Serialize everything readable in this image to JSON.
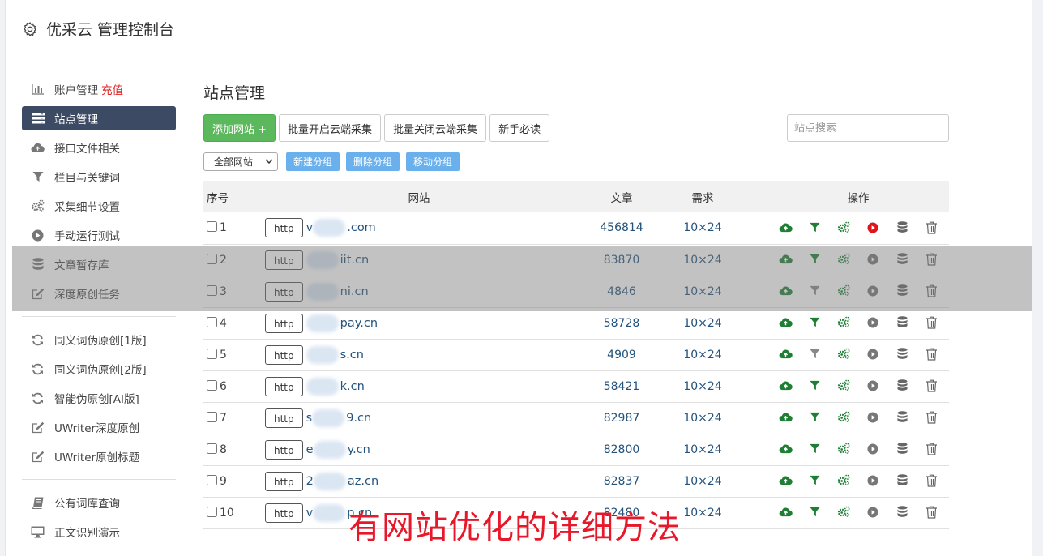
{
  "header": {
    "title": "优采云 管理控制台"
  },
  "sidebar": {
    "group1": [
      {
        "label": "账户管理",
        "badge": "充值",
        "icon": "bar-chart-icon"
      },
      {
        "label": "站点管理",
        "icon": "server-list-icon",
        "active": true
      },
      {
        "label": "接口文件相关",
        "icon": "cloud-upload-icon"
      },
      {
        "label": "栏目与关键词",
        "icon": "filter-icon"
      },
      {
        "label": "采集细节设置",
        "icon": "cogs-icon"
      },
      {
        "label": "手动运行测试",
        "icon": "play-circle-icon"
      },
      {
        "label": "文章暂存库",
        "icon": "database-icon"
      },
      {
        "label": "深度原创任务",
        "icon": "edit-icon"
      }
    ],
    "group2": [
      {
        "label": "同义词伪原创[1版]",
        "icon": "refresh-icon"
      },
      {
        "label": "同义词伪原创[2版]",
        "icon": "refresh-icon"
      },
      {
        "label": "智能伪原创[AI版]",
        "icon": "refresh-icon"
      },
      {
        "label": "UWriter深度原创",
        "icon": "edit-icon"
      },
      {
        "label": "UWriter原创标题",
        "icon": "edit-icon"
      }
    ],
    "group3": [
      {
        "label": "公有词库查询",
        "icon": "book-icon"
      },
      {
        "label": "正文识别演示",
        "icon": "monitor-icon"
      }
    ]
  },
  "main": {
    "title": "站点管理",
    "add_site_label": "添加网站 +",
    "batch_on_label": "批量开启云端采集",
    "batch_off_label": "批量关闭云端采集",
    "newbie_label": "新手必读",
    "search_placeholder": "站点搜索",
    "group_select": "全部网站",
    "new_group_label": "新建分组",
    "delete_group_label": "删除分组",
    "move_group_label": "移动分组"
  },
  "table": {
    "headers": {
      "no": "序号",
      "site": "网站",
      "articles": "文章",
      "demand": "需求",
      "ops": "操作"
    },
    "rows": [
      {
        "no": "1",
        "protocol": "http",
        "site": "v",
        "site_tail": ".com",
        "articles": "456814",
        "demand": "10×24",
        "filter_active": true,
        "play_active": true
      },
      {
        "no": "2",
        "protocol": "http",
        "site": "",
        "site_tail": "iit.cn",
        "articles": "83870",
        "demand": "10×24",
        "filter_active": true,
        "play_active": false
      },
      {
        "no": "3",
        "protocol": "http",
        "site": "",
        "site_tail": "ni.cn",
        "articles": "4846",
        "demand": "10×24",
        "filter_active": false,
        "play_active": false
      },
      {
        "no": "4",
        "protocol": "http",
        "site": "",
        "site_tail": "pay.cn",
        "articles": "58728",
        "demand": "10×24",
        "filter_active": true,
        "play_active": false
      },
      {
        "no": "5",
        "protocol": "http",
        "site": "",
        "site_tail": "s.cn",
        "articles": "4909",
        "demand": "10×24",
        "filter_active": false,
        "play_active": false
      },
      {
        "no": "6",
        "protocol": "http",
        "site": "",
        "site_tail": "k.cn",
        "articles": "58421",
        "demand": "10×24",
        "filter_active": true,
        "play_active": false
      },
      {
        "no": "7",
        "protocol": "http",
        "site": "s",
        "site_tail": "9.cn",
        "articles": "82987",
        "demand": "10×24",
        "filter_active": true,
        "play_active": false
      },
      {
        "no": "8",
        "protocol": "http",
        "site": "e",
        "site_tail": "y.cn",
        "articles": "82800",
        "demand": "10×24",
        "filter_active": true,
        "play_active": false
      },
      {
        "no": "9",
        "protocol": "http",
        "site": "2",
        "site_tail": "az.cn",
        "articles": "82837",
        "demand": "10×24",
        "filter_active": true,
        "play_active": false
      },
      {
        "no": "10",
        "protocol": "http",
        "site": "v",
        "site_tail": "p.cn",
        "articles": "82480",
        "demand": "10×24",
        "filter_active": true,
        "play_active": false
      }
    ]
  },
  "caption": "有网站优化的详细方法",
  "colors": {
    "green": "#5cb85c",
    "icon_green": "#1e7e34",
    "active_red": "#e0151c",
    "link_blue": "#23527c",
    "sidebar_active": "#3d4a63",
    "tag_blue": "#6ab0ec"
  }
}
